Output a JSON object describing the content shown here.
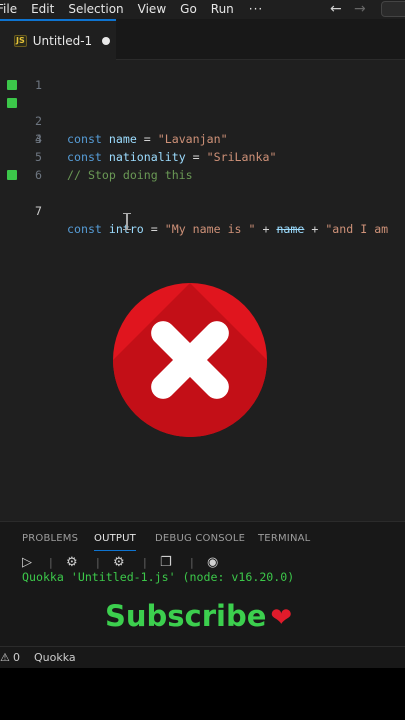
{
  "menubar": {
    "items": [
      "File",
      "Edit",
      "Selection",
      "View",
      "Go",
      "Run"
    ],
    "more": "···",
    "back_icon": "←",
    "forward_icon": "→"
  },
  "tab": {
    "badge": "JS",
    "title": "Untitled-1"
  },
  "editor": {
    "lines": [
      {
        "n": "1",
        "cov": false
      },
      {
        "n": "2",
        "cov": true,
        "kw": "const",
        "var": "name",
        "eq": " = ",
        "str": "\"Lavanjan\""
      },
      {
        "n": "3",
        "cov": true,
        "kw": "const",
        "var": "nationality",
        "eq": " = ",
        "str": "\"SriLanka\""
      },
      {
        "n": "4",
        "cov": false
      },
      {
        "n": "5",
        "cov": false,
        "comment": "// Stop doing this"
      },
      {
        "n": "6",
        "cov": false
      },
      {
        "n": "7",
        "cov": true,
        "kw": "const",
        "var": "intro",
        "eq": " = ",
        "str": "\"My name is \"",
        "plus1": " + ",
        "ref": "name",
        "plus2": " + ",
        "str2": "\"and I am"
      }
    ]
  },
  "panel": {
    "tabs": [
      "PROBLEMS",
      "OUTPUT",
      "DEBUG CONSOLE",
      "TERMINAL"
    ],
    "active_tab": "OUTPUT",
    "output_line": "Quokka 'Untitled-1.js' (node: v16.20.0)"
  },
  "overlay": {
    "subscribe": "Subscribe",
    "heart": "❤"
  },
  "status": {
    "warnings_icon": "⚠",
    "warnings": "0",
    "quokka": "Quokka"
  },
  "colors": {
    "accent": "#0e74d1",
    "coverage": "#3cc74a",
    "error_red": "#e0151e"
  }
}
